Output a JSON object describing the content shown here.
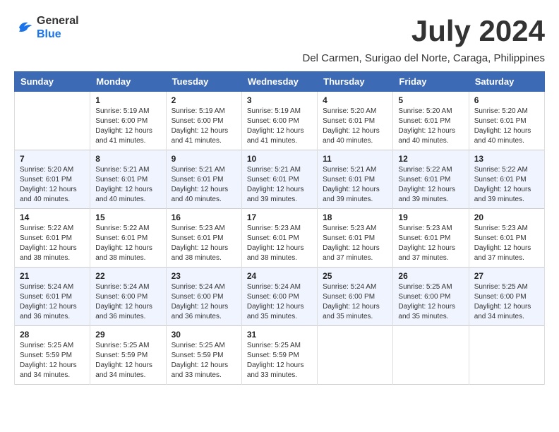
{
  "header": {
    "logo_line1": "General",
    "logo_line2": "Blue",
    "month_year": "July 2024",
    "location": "Del Carmen, Surigao del Norte, Caraga, Philippines"
  },
  "days_of_week": [
    "Sunday",
    "Monday",
    "Tuesday",
    "Wednesday",
    "Thursday",
    "Friday",
    "Saturday"
  ],
  "weeks": [
    [
      {
        "day": "",
        "sunrise": "",
        "sunset": "",
        "daylight": ""
      },
      {
        "day": "1",
        "sunrise": "Sunrise: 5:19 AM",
        "sunset": "Sunset: 6:00 PM",
        "daylight": "Daylight: 12 hours and 41 minutes."
      },
      {
        "day": "2",
        "sunrise": "Sunrise: 5:19 AM",
        "sunset": "Sunset: 6:00 PM",
        "daylight": "Daylight: 12 hours and 41 minutes."
      },
      {
        "day": "3",
        "sunrise": "Sunrise: 5:19 AM",
        "sunset": "Sunset: 6:00 PM",
        "daylight": "Daylight: 12 hours and 41 minutes."
      },
      {
        "day": "4",
        "sunrise": "Sunrise: 5:20 AM",
        "sunset": "Sunset: 6:01 PM",
        "daylight": "Daylight: 12 hours and 40 minutes."
      },
      {
        "day": "5",
        "sunrise": "Sunrise: 5:20 AM",
        "sunset": "Sunset: 6:01 PM",
        "daylight": "Daylight: 12 hours and 40 minutes."
      },
      {
        "day": "6",
        "sunrise": "Sunrise: 5:20 AM",
        "sunset": "Sunset: 6:01 PM",
        "daylight": "Daylight: 12 hours and 40 minutes."
      }
    ],
    [
      {
        "day": "7",
        "sunrise": "Sunrise: 5:20 AM",
        "sunset": "Sunset: 6:01 PM",
        "daylight": "Daylight: 12 hours and 40 minutes."
      },
      {
        "day": "8",
        "sunrise": "Sunrise: 5:21 AM",
        "sunset": "Sunset: 6:01 PM",
        "daylight": "Daylight: 12 hours and 40 minutes."
      },
      {
        "day": "9",
        "sunrise": "Sunrise: 5:21 AM",
        "sunset": "Sunset: 6:01 PM",
        "daylight": "Daylight: 12 hours and 40 minutes."
      },
      {
        "day": "10",
        "sunrise": "Sunrise: 5:21 AM",
        "sunset": "Sunset: 6:01 PM",
        "daylight": "Daylight: 12 hours and 39 minutes."
      },
      {
        "day": "11",
        "sunrise": "Sunrise: 5:21 AM",
        "sunset": "Sunset: 6:01 PM",
        "daylight": "Daylight: 12 hours and 39 minutes."
      },
      {
        "day": "12",
        "sunrise": "Sunrise: 5:22 AM",
        "sunset": "Sunset: 6:01 PM",
        "daylight": "Daylight: 12 hours and 39 minutes."
      },
      {
        "day": "13",
        "sunrise": "Sunrise: 5:22 AM",
        "sunset": "Sunset: 6:01 PM",
        "daylight": "Daylight: 12 hours and 39 minutes."
      }
    ],
    [
      {
        "day": "14",
        "sunrise": "Sunrise: 5:22 AM",
        "sunset": "Sunset: 6:01 PM",
        "daylight": "Daylight: 12 hours and 38 minutes."
      },
      {
        "day": "15",
        "sunrise": "Sunrise: 5:22 AM",
        "sunset": "Sunset: 6:01 PM",
        "daylight": "Daylight: 12 hours and 38 minutes."
      },
      {
        "day": "16",
        "sunrise": "Sunrise: 5:23 AM",
        "sunset": "Sunset: 6:01 PM",
        "daylight": "Daylight: 12 hours and 38 minutes."
      },
      {
        "day": "17",
        "sunrise": "Sunrise: 5:23 AM",
        "sunset": "Sunset: 6:01 PM",
        "daylight": "Daylight: 12 hours and 38 minutes."
      },
      {
        "day": "18",
        "sunrise": "Sunrise: 5:23 AM",
        "sunset": "Sunset: 6:01 PM",
        "daylight": "Daylight: 12 hours and 37 minutes."
      },
      {
        "day": "19",
        "sunrise": "Sunrise: 5:23 AM",
        "sunset": "Sunset: 6:01 PM",
        "daylight": "Daylight: 12 hours and 37 minutes."
      },
      {
        "day": "20",
        "sunrise": "Sunrise: 5:23 AM",
        "sunset": "Sunset: 6:01 PM",
        "daylight": "Daylight: 12 hours and 37 minutes."
      }
    ],
    [
      {
        "day": "21",
        "sunrise": "Sunrise: 5:24 AM",
        "sunset": "Sunset: 6:01 PM",
        "daylight": "Daylight: 12 hours and 36 minutes."
      },
      {
        "day": "22",
        "sunrise": "Sunrise: 5:24 AM",
        "sunset": "Sunset: 6:00 PM",
        "daylight": "Daylight: 12 hours and 36 minutes."
      },
      {
        "day": "23",
        "sunrise": "Sunrise: 5:24 AM",
        "sunset": "Sunset: 6:00 PM",
        "daylight": "Daylight: 12 hours and 36 minutes."
      },
      {
        "day": "24",
        "sunrise": "Sunrise: 5:24 AM",
        "sunset": "Sunset: 6:00 PM",
        "daylight": "Daylight: 12 hours and 35 minutes."
      },
      {
        "day": "25",
        "sunrise": "Sunrise: 5:24 AM",
        "sunset": "Sunset: 6:00 PM",
        "daylight": "Daylight: 12 hours and 35 minutes."
      },
      {
        "day": "26",
        "sunrise": "Sunrise: 5:25 AM",
        "sunset": "Sunset: 6:00 PM",
        "daylight": "Daylight: 12 hours and 35 minutes."
      },
      {
        "day": "27",
        "sunrise": "Sunrise: 5:25 AM",
        "sunset": "Sunset: 6:00 PM",
        "daylight": "Daylight: 12 hours and 34 minutes."
      }
    ],
    [
      {
        "day": "28",
        "sunrise": "Sunrise: 5:25 AM",
        "sunset": "Sunset: 5:59 PM",
        "daylight": "Daylight: 12 hours and 34 minutes."
      },
      {
        "day": "29",
        "sunrise": "Sunrise: 5:25 AM",
        "sunset": "Sunset: 5:59 PM",
        "daylight": "Daylight: 12 hours and 34 minutes."
      },
      {
        "day": "30",
        "sunrise": "Sunrise: 5:25 AM",
        "sunset": "Sunset: 5:59 PM",
        "daylight": "Daylight: 12 hours and 33 minutes."
      },
      {
        "day": "31",
        "sunrise": "Sunrise: 5:25 AM",
        "sunset": "Sunset: 5:59 PM",
        "daylight": "Daylight: 12 hours and 33 minutes."
      },
      {
        "day": "",
        "sunrise": "",
        "sunset": "",
        "daylight": ""
      },
      {
        "day": "",
        "sunrise": "",
        "sunset": "",
        "daylight": ""
      },
      {
        "day": "",
        "sunrise": "",
        "sunset": "",
        "daylight": ""
      }
    ]
  ]
}
